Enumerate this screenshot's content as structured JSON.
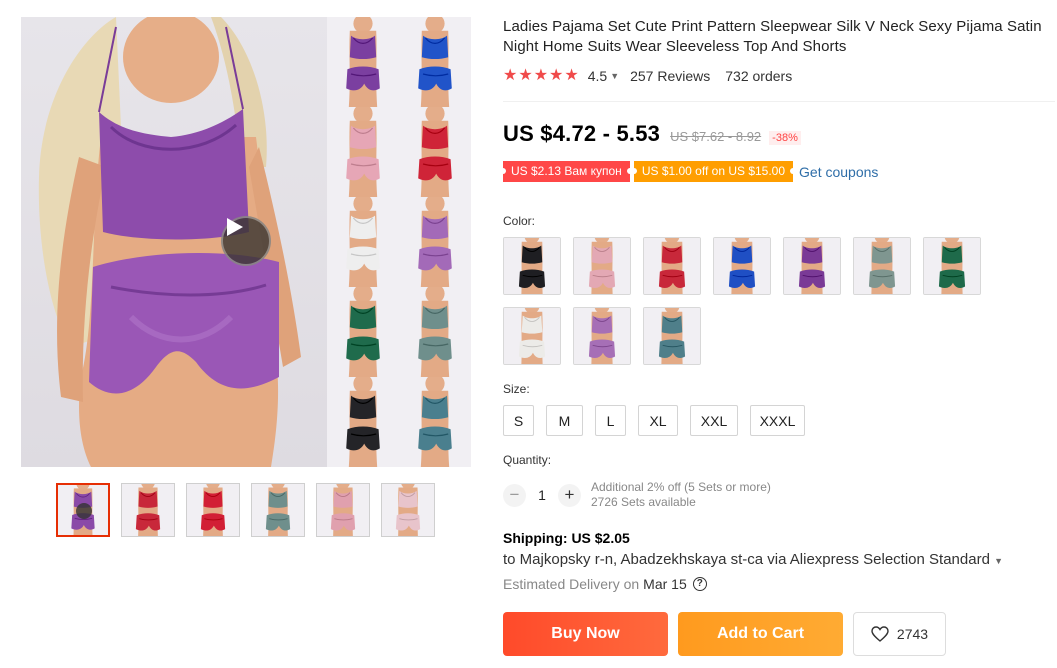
{
  "product": {
    "title": "Ladies Pajama Set Cute Print Pattern Sleepwear Silk V Neck Sexy Pijama Satin Night Home Suits Wear Sleeveless Top And Shorts",
    "rating": "4.5",
    "stars": 5,
    "reviews": "257 Reviews",
    "orders": "732 orders"
  },
  "price": {
    "current": "US $4.72 - 5.53",
    "original": "US $7.62 - 8.92",
    "discount": "-38%"
  },
  "coupons": {
    "store_coupon": "US $2.13 Вам купон",
    "select_coupon": "US $1.00 off on US $15.00",
    "get_coupons": "Get coupons"
  },
  "color": {
    "label": "Color:",
    "options": [
      {
        "name": "black",
        "hex": "#1e1e22"
      },
      {
        "name": "pink",
        "hex": "#e3a8b4"
      },
      {
        "name": "red",
        "hex": "#c8283a"
      },
      {
        "name": "blue",
        "hex": "#1f4fc4"
      },
      {
        "name": "purple",
        "hex": "#7a3a96"
      },
      {
        "name": "grey-green",
        "hex": "#7f9690"
      },
      {
        "name": "dark-green",
        "hex": "#1e6a4a"
      },
      {
        "name": "white",
        "hex": "#ecebe8"
      },
      {
        "name": "lavender",
        "hex": "#a66fb6"
      },
      {
        "name": "teal",
        "hex": "#4f7f8a"
      }
    ]
  },
  "size": {
    "label": "Size:",
    "options": [
      "S",
      "M",
      "L",
      "XL",
      "XXL",
      "XXXL"
    ]
  },
  "quantity": {
    "label": "Quantity:",
    "value": "1",
    "minus": "−",
    "plus": "+",
    "bulk_note": "Additional 2% off (5 Sets or more)",
    "available": "2726 Sets available"
  },
  "shipping": {
    "label": "Shipping:",
    "price": "US $2.05",
    "destination": "to Majkopsky r-n, Abadzekhskaya st-ca via Aliexpress Selection Standard",
    "delivery_label": "Estimated Delivery on",
    "delivery_date": "Mar 15",
    "help": "?"
  },
  "actions": {
    "buy_now": "Buy Now",
    "add_to_cart": "Add to Cart",
    "wishlist_count": "2743"
  },
  "gallery": {
    "collage_colors": [
      "#7b3fa0",
      "#2154c9",
      "#e6a6b6",
      "#cf2438",
      "#eeeeee",
      "#a36ab8",
      "#1f6b4c",
      "#6f8f8c",
      "#242428",
      "#4a7f8e"
    ],
    "thumb_colors": [
      "#8a4aa8",
      "#c8283a",
      "#d21f35",
      "#6f8f8c",
      "#e0a0ae",
      "#e8c4cb"
    ]
  }
}
